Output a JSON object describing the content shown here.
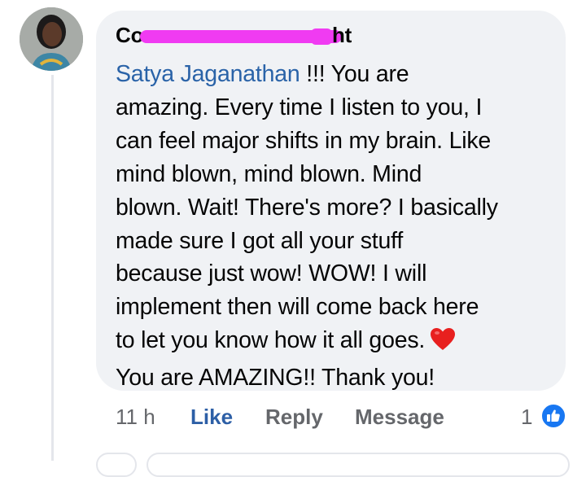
{
  "comment": {
    "author_visible": "Co",
    "author_visible_end": "ht",
    "mention": "Satya Jaganathan",
    "lines": [
      " !!! You are",
      "amazing. Every time I listen to you, I",
      "can feel major shifts in my brain. Like",
      "mind blown, mind blown. Mind",
      "blown. Wait! There's more? I basically",
      "made sure I got all your stuff",
      "because just wow! WOW! I will",
      "implement then will come back here",
      "to let you know how it all goes.",
      "You are AMAZING!! Thank you!"
    ],
    "emoji": "heart",
    "heart_color": "#e8201f"
  },
  "actions": {
    "time": "11 h",
    "like": "Like",
    "reply": "Reply",
    "message": "Message"
  },
  "reactions": {
    "count": "1",
    "icon": "thumbs-up-icon",
    "badge_color": "#1877f2"
  },
  "colors": {
    "bubble": "#f0f2f5",
    "mention": "#2a63a8",
    "like_active": "#2d5fa6",
    "redaction": "#f03bf2"
  }
}
